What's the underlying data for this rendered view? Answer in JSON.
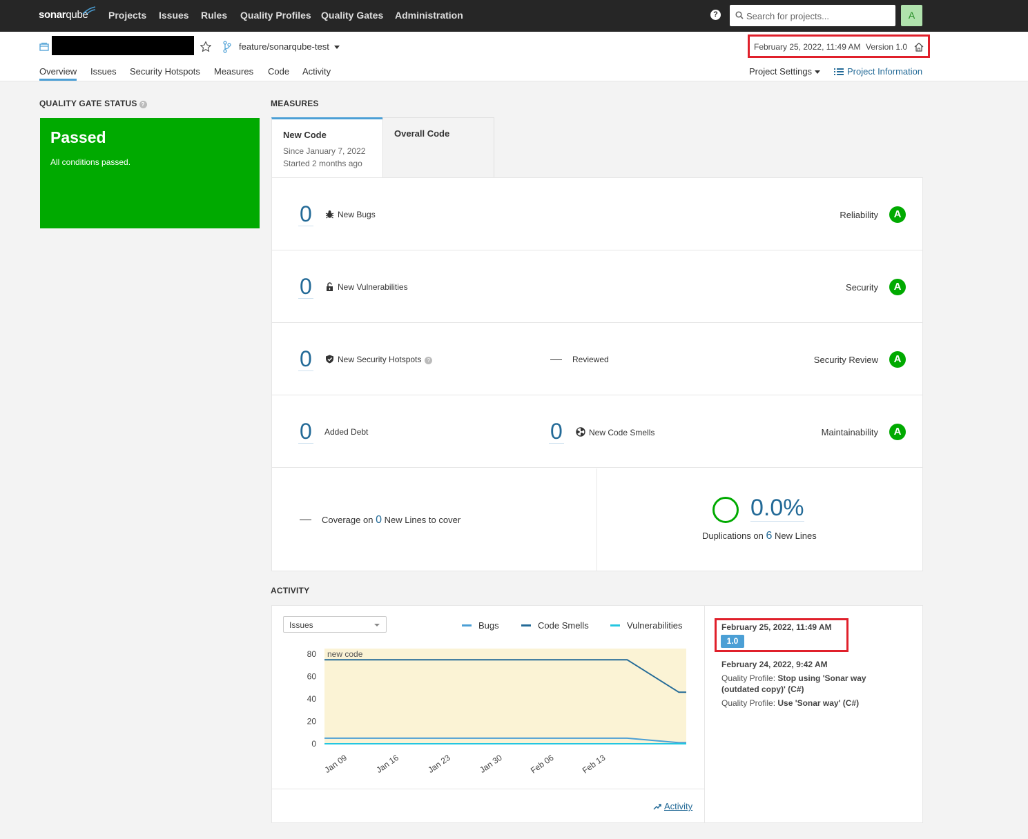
{
  "topnav": {
    "logo_bold": "sonar",
    "logo_light": "qube",
    "items": [
      "Projects",
      "Issues",
      "Rules",
      "Quality Profiles",
      "Quality Gates",
      "Administration"
    ],
    "search_placeholder": "Search for projects...",
    "avatar_letter": "A"
  },
  "project": {
    "branch": "feature/sonarqube-test",
    "analysis_date": "February 25, 2022, 11:49 AM",
    "version": "Version 1.0",
    "tabs": [
      "Overview",
      "Issues",
      "Security Hotspots",
      "Measures",
      "Code",
      "Activity"
    ],
    "settings_label": "Project Settings",
    "info_label": "Project Information"
  },
  "quality_gate": {
    "title": "QUALITY GATE STATUS",
    "status": "Passed",
    "message": "All conditions passed."
  },
  "measures": {
    "title": "MEASURES",
    "tab_new": "New Code",
    "tab_new_since": "Since January 7, 2022",
    "tab_new_started": "Started 2 months ago",
    "tab_overall": "Overall Code",
    "bugs": {
      "value": "0",
      "label": "New Bugs",
      "category": "Reliability",
      "grade": "A"
    },
    "vulnerabilities": {
      "value": "0",
      "label": "New Vulnerabilities",
      "category": "Security",
      "grade": "A"
    },
    "hotspots": {
      "value": "0",
      "label": "New Security Hotspots",
      "reviewed_label": "Reviewed",
      "category": "Security Review",
      "grade": "A"
    },
    "debt": {
      "value": "0",
      "label": "Added Debt",
      "smells_value": "0",
      "smells_label": "New Code Smells",
      "category": "Maintainability",
      "grade": "A"
    },
    "coverage": {
      "prefix": "Coverage on",
      "lines": "0",
      "suffix": "New Lines to cover"
    },
    "duplications": {
      "value": "0.0%",
      "prefix": "Duplications on",
      "lines": "6",
      "suffix": "New Lines"
    }
  },
  "activity": {
    "title": "ACTIVITY",
    "select_value": "Issues",
    "legend": [
      "Bugs",
      "Code Smells",
      "Vulnerabilities"
    ],
    "link_label": "Activity",
    "events": [
      {
        "date": "February 25, 2022, 11:49 AM",
        "version": "1.0"
      },
      {
        "date": "February 24, 2022, 9:42 AM",
        "qp1_label": "Quality Profile:",
        "qp1_value": "Stop using 'Sonar way (outdated copy)' (C#)",
        "qp2_label": "Quality Profile:",
        "qp2_value": "Use 'Sonar way' (C#)"
      }
    ]
  },
  "chart_data": {
    "type": "line",
    "new_code_label": "new code",
    "x_ticks": [
      "Jan 09",
      "Jan 16",
      "Jan 23",
      "Jan 30",
      "Feb 06",
      "Feb 13"
    ],
    "y_ticks": [
      80,
      60,
      40,
      20,
      0
    ],
    "ylim": [
      0,
      85
    ],
    "series": [
      {
        "name": "Bugs",
        "color": "#4b9fd5",
        "points": [
          [
            "Jan 07",
            5
          ],
          [
            "Feb 17",
            5
          ],
          [
            "Feb 24",
            1
          ],
          [
            "Feb 25",
            1
          ]
        ]
      },
      {
        "name": "Code Smells",
        "color": "#236a97",
        "points": [
          [
            "Jan 07",
            75
          ],
          [
            "Feb 17",
            75
          ],
          [
            "Feb 24",
            46
          ],
          [
            "Feb 25",
            46
          ]
        ]
      },
      {
        "name": "Vulnerabilities",
        "color": "#24c6e0",
        "points": [
          [
            "Jan 07",
            0
          ],
          [
            "Feb 25",
            0
          ]
        ]
      }
    ]
  },
  "colors": {
    "passed": "#00aa00",
    "link": "#236a97",
    "highlight": "#e0202b"
  }
}
